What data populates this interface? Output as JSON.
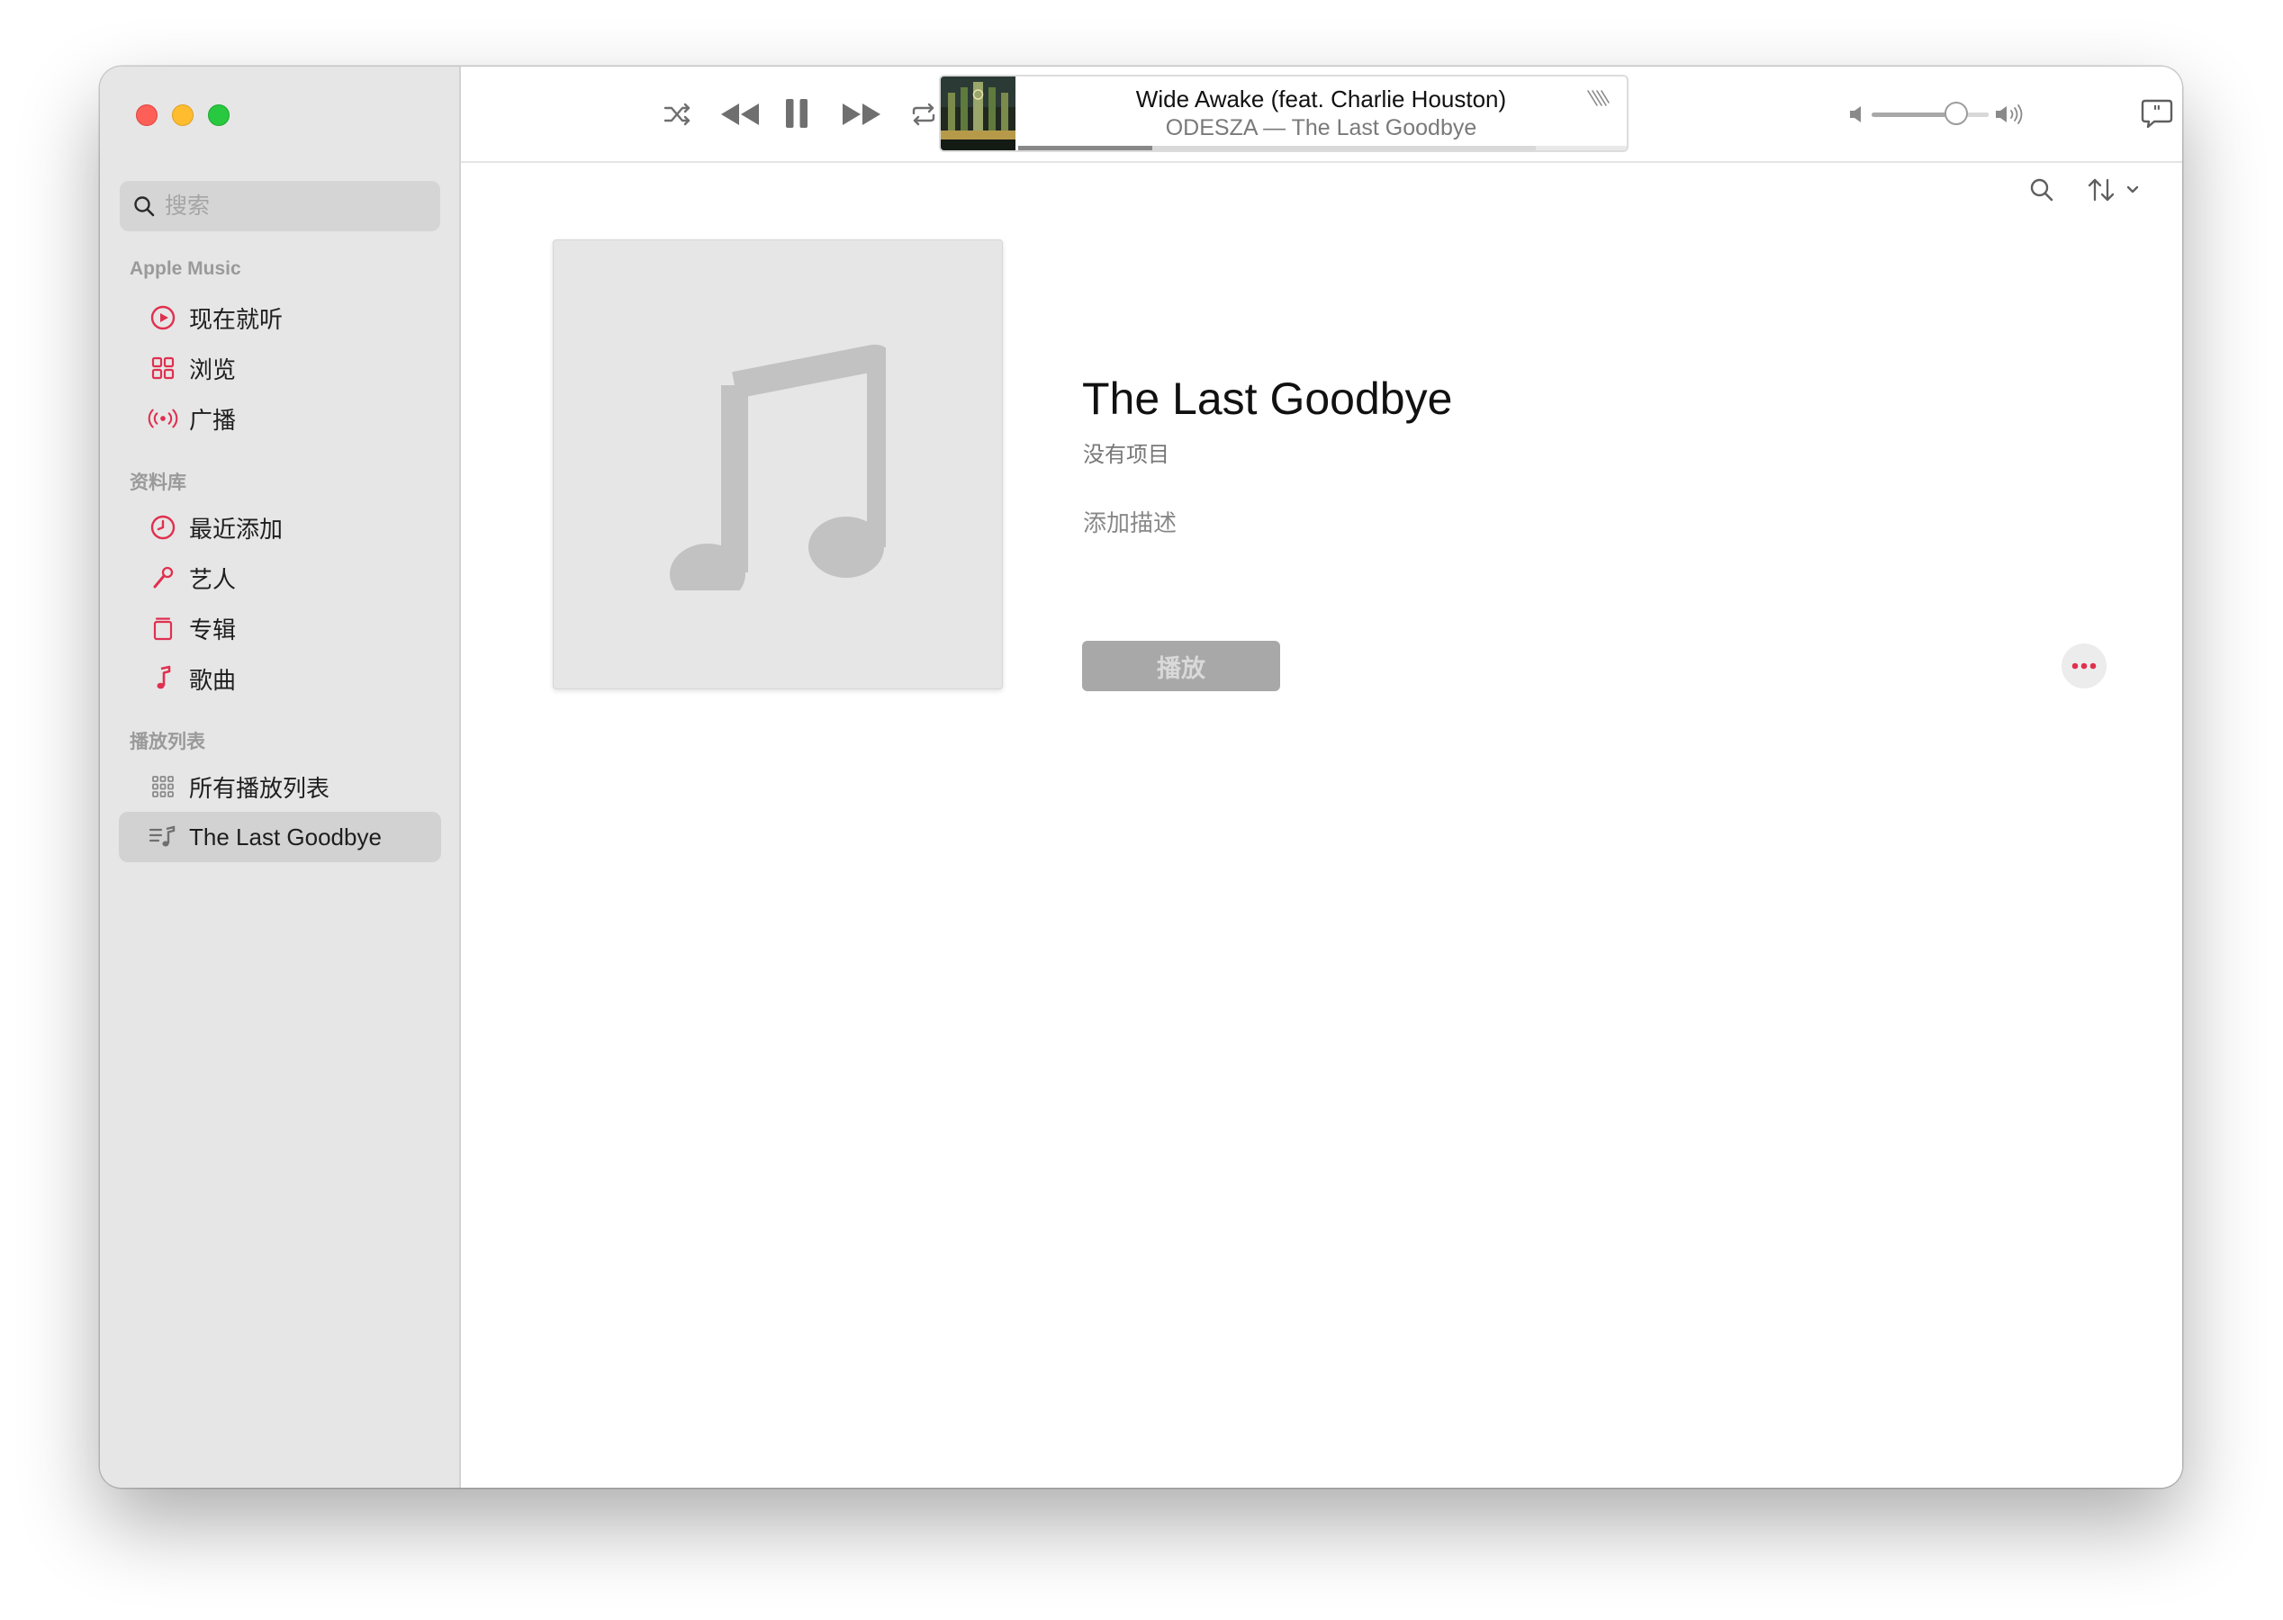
{
  "search": {
    "placeholder": "搜索"
  },
  "sidebar": {
    "sections": [
      {
        "title": "Apple Music",
        "items": [
          {
            "label": "现在就听",
            "icon": "play-circle-icon"
          },
          {
            "label": "浏览",
            "icon": "grid-icon"
          },
          {
            "label": "广播",
            "icon": "radio-icon"
          }
        ]
      },
      {
        "title": "资料库",
        "items": [
          {
            "label": "最近添加",
            "icon": "clock-icon"
          },
          {
            "label": "艺人",
            "icon": "microphone-icon"
          },
          {
            "label": "专辑",
            "icon": "album-icon"
          },
          {
            "label": "歌曲",
            "icon": "music-note-icon"
          }
        ]
      },
      {
        "title": "播放列表",
        "items": [
          {
            "label": "所有播放列表",
            "icon": "grid-dots-icon"
          },
          {
            "label": "The Last Goodbye",
            "icon": "playlist-icon",
            "selected": true
          }
        ]
      }
    ]
  },
  "now_playing": {
    "title": "Wide Awake (feat. Charlie Houston)",
    "subtitle": "ODESZA — The Last Goodbye",
    "progress": 0.22
  },
  "volume": {
    "level": 0.72
  },
  "playlist": {
    "title": "The Last Goodbye",
    "count": "没有项目",
    "description_placeholder": "添加描述",
    "play_label": "播放"
  },
  "colors": {
    "accent": "#e0304f",
    "sidebar_bg": "#e6e6e6",
    "selected_bg": "#d2d2d2"
  }
}
